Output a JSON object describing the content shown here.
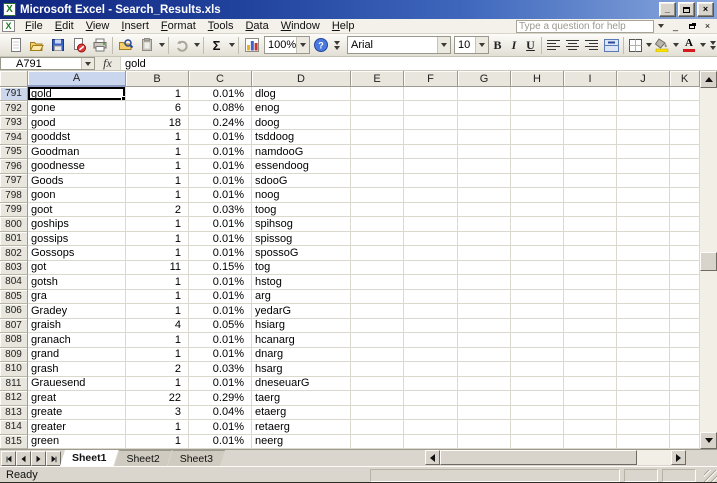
{
  "window": {
    "title": "Microsoft Excel - Search_Results.xls"
  },
  "menu_bar": {
    "items": [
      "File",
      "Edit",
      "View",
      "Insert",
      "Format",
      "Tools",
      "Data",
      "Window",
      "Help"
    ],
    "question_box": "Type a question for help"
  },
  "standard_toolbar": {
    "autosum_label": "Σ",
    "zoom_value": "100%",
    "icons": [
      "new",
      "open",
      "save",
      "permission",
      "print",
      "search",
      "paste",
      "undo",
      "autosum",
      "chart-wizard",
      "zoom",
      "help"
    ]
  },
  "formatting_toolbar": {
    "font_name": "Arial",
    "font_size": "10",
    "bold_label": "B",
    "italic_label": "I",
    "underline_label": "U",
    "font_color_label": "A"
  },
  "formula_bar": {
    "cell_reference": "A791",
    "fx_label": "fx",
    "formula_value": "gold"
  },
  "grid": {
    "column_headers": [
      "A",
      "B",
      "C",
      "D",
      "E",
      "F",
      "G",
      "H",
      "I",
      "J",
      "K"
    ],
    "selected_cell": "A791",
    "rows": [
      {
        "row": 791,
        "A": "gold",
        "B": "1",
        "C": "0.01%",
        "D": "dlog"
      },
      {
        "row": 792,
        "A": "gone",
        "B": "6",
        "C": "0.08%",
        "D": "enog"
      },
      {
        "row": 793,
        "A": "good",
        "B": "18",
        "C": "0.24%",
        "D": "doog"
      },
      {
        "row": 794,
        "A": "gooddst",
        "B": "1",
        "C": "0.01%",
        "D": "tsddoog"
      },
      {
        "row": 795,
        "A": "Goodman",
        "B": "1",
        "C": "0.01%",
        "D": "namdooG"
      },
      {
        "row": 796,
        "A": "goodnesse",
        "B": "1",
        "C": "0.01%",
        "D": "essendoog"
      },
      {
        "row": 797,
        "A": "Goods",
        "B": "1",
        "C": "0.01%",
        "D": "sdooG"
      },
      {
        "row": 798,
        "A": "goon",
        "B": "1",
        "C": "0.01%",
        "D": "noog"
      },
      {
        "row": 799,
        "A": "goot",
        "B": "2",
        "C": "0.03%",
        "D": "toog"
      },
      {
        "row": 800,
        "A": "goships",
        "B": "1",
        "C": "0.01%",
        "D": "spihsog"
      },
      {
        "row": 801,
        "A": "gossips",
        "B": "1",
        "C": "0.01%",
        "D": "spissog"
      },
      {
        "row": 802,
        "A": "Gossops",
        "B": "1",
        "C": "0.01%",
        "D": "spossoG"
      },
      {
        "row": 803,
        "A": "got",
        "B": "11",
        "C": "0.15%",
        "D": "tog"
      },
      {
        "row": 804,
        "A": "gotsh",
        "B": "1",
        "C": "0.01%",
        "D": "hstog"
      },
      {
        "row": 805,
        "A": "gra",
        "B": "1",
        "C": "0.01%",
        "D": "arg"
      },
      {
        "row": 806,
        "A": "Gradey",
        "B": "1",
        "C": "0.01%",
        "D": "yedarG"
      },
      {
        "row": 807,
        "A": "graish",
        "B": "4",
        "C": "0.05%",
        "D": "hsiarg"
      },
      {
        "row": 808,
        "A": "granach",
        "B": "1",
        "C": "0.01%",
        "D": "hcanarg"
      },
      {
        "row": 809,
        "A": "grand",
        "B": "1",
        "C": "0.01%",
        "D": "dnarg"
      },
      {
        "row": 810,
        "A": "grash",
        "B": "2",
        "C": "0.03%",
        "D": "hsarg"
      },
      {
        "row": 811,
        "A": "Grauesend",
        "B": "1",
        "C": "0.01%",
        "D": "dneseuarG"
      },
      {
        "row": 812,
        "A": "great",
        "B": "22",
        "C": "0.29%",
        "D": "taerg"
      },
      {
        "row": 813,
        "A": "greate",
        "B": "3",
        "C": "0.04%",
        "D": "etaerg"
      },
      {
        "row": 814,
        "A": "greater",
        "B": "1",
        "C": "0.01%",
        "D": "retaerg"
      },
      {
        "row": 815,
        "A": "green",
        "B": "1",
        "C": "0.01%",
        "D": "neerg"
      }
    ]
  },
  "sheet_tabs": {
    "tabs": [
      {
        "label": "Sheet1",
        "active": true
      },
      {
        "label": "Sheet2",
        "active": false
      },
      {
        "label": "Sheet3",
        "active": false
      }
    ]
  },
  "status_bar": {
    "mode": "Ready"
  },
  "colors": {
    "titlebar_start": "#10257e",
    "titlebar_end": "#8aa8dd",
    "selected_header": "#c9d6ee",
    "toolbar_bg": "#ece9e0",
    "fill_color_swatch": "#ffe400",
    "font_color_swatch": "#d41a1a"
  }
}
